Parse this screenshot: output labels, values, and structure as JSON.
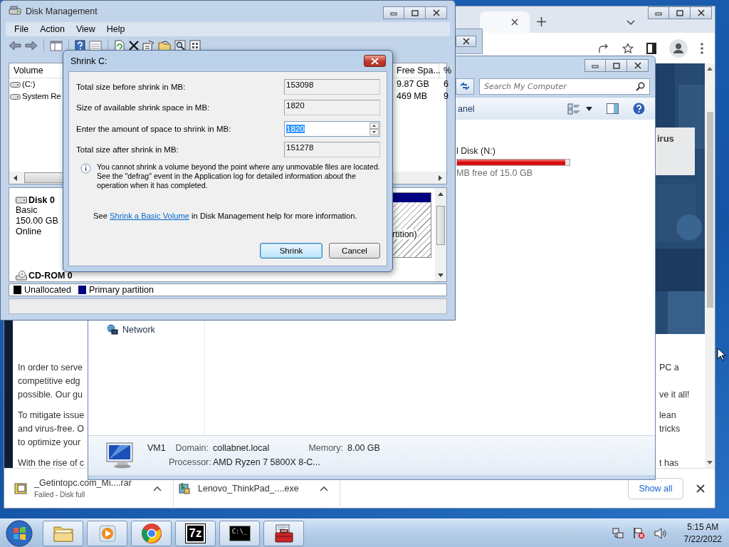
{
  "browser": {
    "paragraphs": [
      {
        "lines": [
          {
            "left": "In order to serve",
            "right": "PC a"
          },
          {
            "left": "competitive edg"
          },
          {
            "left": "possible. Our gu",
            "right": "ve it all!"
          }
        ]
      },
      {
        "lines": [
          {
            "left": "To mitigate issue",
            "right": "lean"
          },
          {
            "left": "and virus-free. O",
            "right": "tricks"
          },
          {
            "left": "to optimize your"
          }
        ]
      },
      {
        "lines": [
          {
            "left": "With the rise of c",
            "right": "t has"
          }
        ]
      }
    ],
    "banner": "irus",
    "downloads": [
      {
        "name": "_Getintopc.com_Mi....rar",
        "status": "Failed - Disk full",
        "kind": "archive"
      },
      {
        "name": "Lenovo_ThinkPad_....exe",
        "kind": "installer"
      }
    ],
    "show_all": "Show all"
  },
  "explorer": {
    "search": {
      "placeholder": "Search My Computer"
    },
    "command": "anel",
    "drive": {
      "name": "l Disk (N:)",
      "level": 0.96,
      "free": "MB free of 15.0 GB"
    },
    "nav": [
      "Network"
    ],
    "computer": {
      "name": "VM1",
      "domain_label": "Domain:",
      "domain": "collabnet.local",
      "memory_label": "Memory:",
      "memory": "8.00 GB",
      "processor_label": "Processor:",
      "processor": "AMD Ryzen 7 5800X 8-C..."
    }
  },
  "disk_management": {
    "title": "Disk Management",
    "menu": [
      "File",
      "Action",
      "View",
      "Help"
    ],
    "columns": [
      "Volume",
      "Free Spa...",
      "%"
    ],
    "volumes": [
      {
        "name": "(C:)",
        "free": "9.87 GB",
        "percent": "6"
      },
      {
        "name": "System Re",
        "free": "469 MB",
        "percent": "9"
      }
    ],
    "disks": [
      {
        "name": "Disk 0",
        "kind": "disk",
        "lines": [
          "Basic",
          "150.00 GB",
          "Online"
        ],
        "partition": "rtition)"
      },
      {
        "name": "CD-ROM 0",
        "kind": "cdrom"
      }
    ],
    "legend": [
      {
        "label": "Unallocated",
        "color": "#000000"
      },
      {
        "label": "Primary partition",
        "color": "#000080"
      }
    ]
  },
  "dialog": {
    "title": "Shrink C:",
    "fields": [
      {
        "label": "Total size before shrink in MB:",
        "value": "153098",
        "kind": "readonly",
        "selected": false
      },
      {
        "label": "Size of available shrink space in MB:",
        "value": "1820",
        "kind": "readonly",
        "selected": false
      },
      {
        "label": "Enter the amount of space to shrink in MB:",
        "value": "1820",
        "kind": "spin",
        "selected": true
      },
      {
        "label": "Total size after shrink in MB:",
        "value": "151278",
        "kind": "readonly",
        "selected": false
      }
    ],
    "info": "You cannot shrink a volume beyond the point where any unmovable files are located. See the \"defrag\" event in the Application log for detailed information about the operation when it has completed.",
    "help": {
      "before": "See",
      "link": "Shrink a Basic Volume",
      "after": "in Disk Management help for more information."
    },
    "buttons": [
      {
        "label": "Shrink",
        "default": true
      },
      {
        "label": "Cancel",
        "default": false
      }
    ]
  },
  "taskbar": {
    "apps": [
      {
        "kind": "folder"
      },
      {
        "kind": "media"
      },
      {
        "kind": "browser"
      },
      {
        "kind": "archiver",
        "label": "7z"
      },
      {
        "kind": "terminal",
        "label": "C:\\_"
      },
      {
        "kind": "toolbox"
      }
    ],
    "time": "5:15 AM",
    "date": "7/22/2022"
  }
}
